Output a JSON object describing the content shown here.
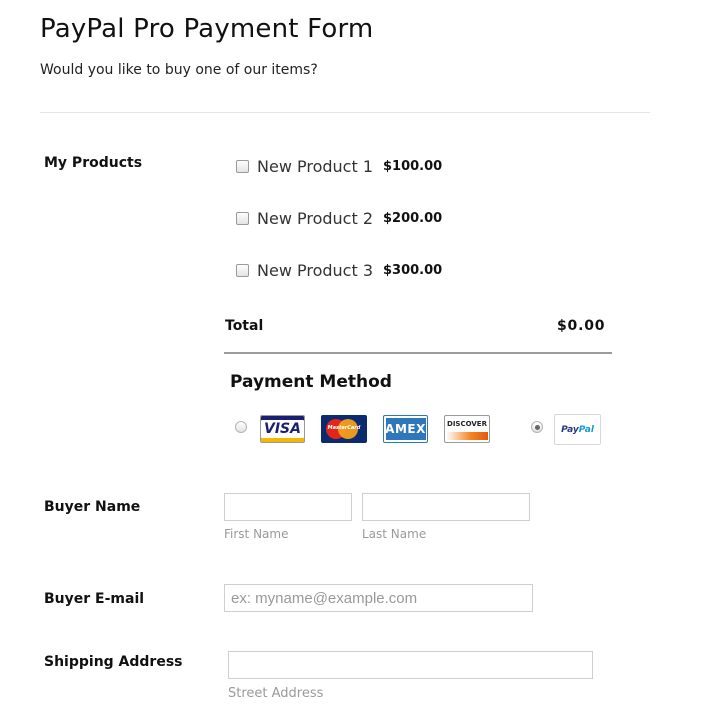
{
  "header": {
    "title": "PayPal Pro Payment Form",
    "subtitle": "Would you like to buy one of our items?"
  },
  "products": {
    "label": "My Products",
    "items": [
      {
        "name": "New Product 1",
        "price": "$100.00",
        "checked": false
      },
      {
        "name": "New Product 2",
        "price": "$200.00",
        "checked": false
      },
      {
        "name": "New Product 3",
        "price": "$300.00",
        "checked": false
      }
    ],
    "total_label": "Total",
    "total_value": "$0.00"
  },
  "payment": {
    "title": "Payment Method",
    "options": [
      {
        "id": "credit-card",
        "selected": false,
        "cards": [
          "VISA",
          "MasterCard",
          "AMEX",
          "DISCOVER"
        ]
      },
      {
        "id": "paypal",
        "selected": true,
        "logo_a": "Pay",
        "logo_b": "Pal"
      }
    ]
  },
  "buyer_name": {
    "label": "Buyer Name",
    "first_value": "",
    "last_value": "",
    "first_sublabel": "First Name",
    "last_sublabel": "Last Name"
  },
  "buyer_email": {
    "label": "Buyer E-mail",
    "placeholder": "ex: myname@example.com"
  },
  "shipping": {
    "label": "Shipping Address",
    "street_value": "",
    "street_sublabel": "Street Address"
  },
  "colors": {
    "visa_blue": "#1a1f71",
    "paypal_dark": "#253b80",
    "paypal_light": "#179bd7",
    "amex_blue": "#2e77bb",
    "discover_orange": "#f58220"
  }
}
